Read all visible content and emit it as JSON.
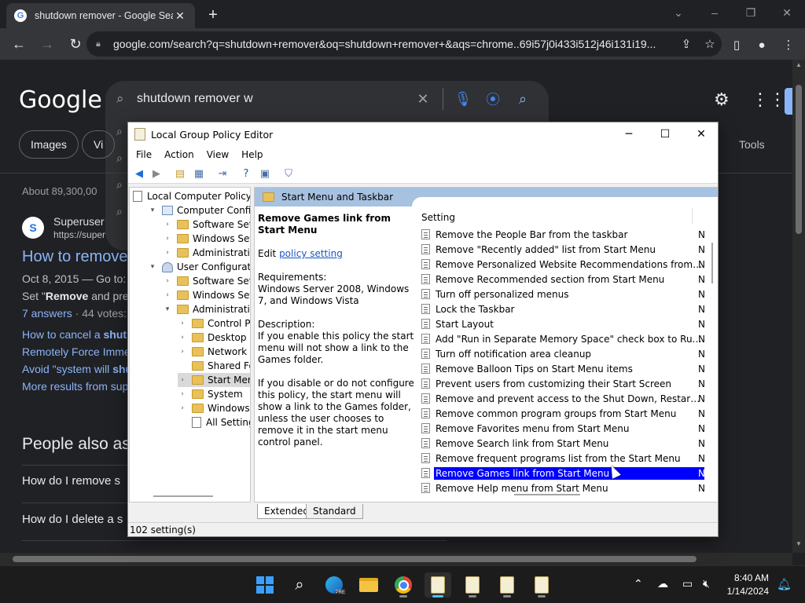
{
  "browser": {
    "tab_title": "shutdown remover - Google Search",
    "favicon_letter": "G",
    "url": "google.com/search?q=shutdown+remover&oq=shutdown+remover+&aqs=chrome..69i57j0i433i512j46i131i19..."
  },
  "google": {
    "logo": "Google",
    "query": "shutdown remover w",
    "chips": [
      "Images",
      "Vi"
    ],
    "tools": "Tools",
    "about": "About 89,300,00",
    "result": {
      "site_name": "Superuser",
      "site_url": "https://super",
      "site_icon": "S",
      "title": "How to remove",
      "meta": "Oct 8, 2015 — Go to:",
      "snippet_prefix": "Set \"",
      "snippet_bold": "Remove",
      "snippet_rest": " and pre",
      "answers": "7 answers",
      "votes": " · 44 votes:"
    },
    "sublinks": [
      {
        "text": "How to cancel a ",
        "bold": "shut"
      },
      {
        "text": "Remotely Force Imme",
        "bold": ""
      },
      {
        "text": "Avoid \"system will ",
        "bold": "shu"
      },
      {
        "text": "More results from sup",
        "bold": ""
      }
    ],
    "paa_title": "People also as",
    "paa_questions": [
      "How do I remove s",
      "How do I delete a s"
    ]
  },
  "gpedit": {
    "title": "Local Group Policy Editor",
    "menus": [
      "File",
      "Action",
      "View",
      "Help"
    ],
    "tree": [
      {
        "label": "Local Computer Policy",
        "icon": "doc",
        "indent": 0,
        "chev": ""
      },
      {
        "label": "Computer Configura",
        "icon": "pc",
        "indent": 1,
        "chev": "v"
      },
      {
        "label": "Software Settings",
        "icon": "fold",
        "indent": 2,
        "chev": ">"
      },
      {
        "label": "Windows Setting",
        "icon": "fold",
        "indent": 2,
        "chev": ">"
      },
      {
        "label": "Administrative Te",
        "icon": "fold",
        "indent": 2,
        "chev": ">"
      },
      {
        "label": "User Configuration",
        "icon": "user",
        "indent": 1,
        "chev": "v"
      },
      {
        "label": "Software Settings",
        "icon": "fold",
        "indent": 2,
        "chev": ">"
      },
      {
        "label": "Windows Setting",
        "icon": "fold",
        "indent": 2,
        "chev": ">"
      },
      {
        "label": "Administrative Te",
        "icon": "fold",
        "indent": 2,
        "chev": "v"
      },
      {
        "label": "Control Panel",
        "icon": "fold",
        "indent": 3,
        "chev": ">"
      },
      {
        "label": "Desktop",
        "icon": "fold",
        "indent": 3,
        "chev": ">"
      },
      {
        "label": "Network",
        "icon": "fold",
        "indent": 3,
        "chev": ">"
      },
      {
        "label": "Shared Folder",
        "icon": "fold",
        "indent": 3,
        "chev": ""
      },
      {
        "label": "Start Menu ar",
        "icon": "fold",
        "indent": 3,
        "chev": ">",
        "selected": true
      },
      {
        "label": "System",
        "icon": "fold",
        "indent": 3,
        "chev": ">"
      },
      {
        "label": "Windows Cor",
        "icon": "fold",
        "indent": 3,
        "chev": ">"
      },
      {
        "label": "All Settings",
        "icon": "doc",
        "indent": 3,
        "chev": ""
      }
    ],
    "folder_header": "Start Menu and Taskbar",
    "desc": {
      "title": "Remove Games link from Start Menu",
      "edit_prefix": "Edit ",
      "edit_link": "policy setting",
      "requirements": "Requirements:\nWindows Server 2008, Windows 7, and Windows Vista",
      "description": "Description:\nIf you enable this policy the start menu will not show a link to the Games folder.",
      "description2": "If you disable or do not configure this policy, the start menu will show a link to the Games folder, unless the user chooses to remove it in the start menu control panel."
    },
    "column_setting": "Setting",
    "settings": [
      "Remove the People Bar from the taskbar",
      "Remove \"Recently added\" list from Start Menu",
      "Remove Personalized Website Recommendations from the ...",
      "Remove Recommended section from Start Menu",
      "Turn off personalized menus",
      "Lock the Taskbar",
      "Start Layout",
      "Add \"Run in Separate Memory Space\" check box to Run dial...",
      "Turn off notification area cleanup",
      "Remove Balloon Tips on Start Menu items",
      "Prevent users from customizing their Start Screen",
      "Remove and prevent access to the Shut Down, Restart, Sleep...",
      "Remove common program groups from Start Menu",
      "Remove Favorites menu from Start Menu",
      "Remove Search link from Start Menu",
      "Remove frequent programs list from the Start Menu",
      "Remove Games link from Start Menu",
      "Remove Help menu from Start Menu"
    ],
    "selected_setting_index": 16,
    "state_glyph": "N",
    "tabs": [
      "Extended",
      "Standard"
    ],
    "status": "102 setting(s)"
  },
  "taskbar": {
    "time": "8:40 AM",
    "date": "1/14/2024",
    "edge_badge": "PRE"
  }
}
